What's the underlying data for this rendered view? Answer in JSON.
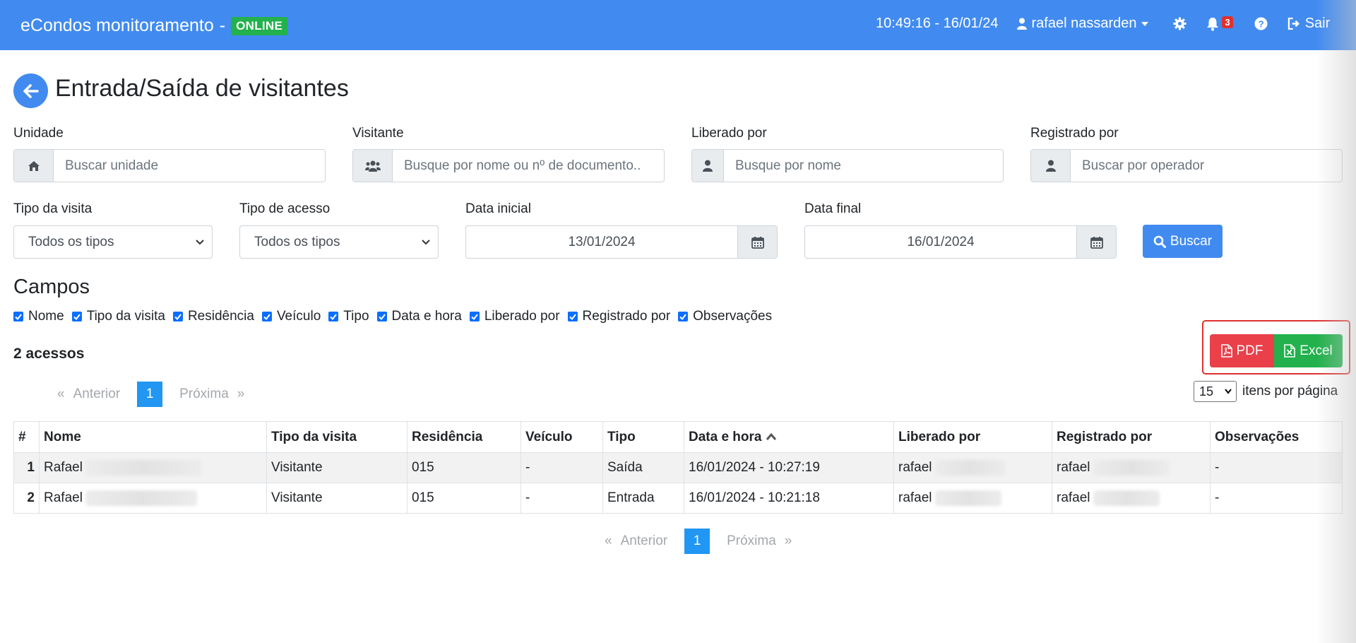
{
  "navbar": {
    "brand": "eCondos monitoramento",
    "separator": "-",
    "status": "ONLINE",
    "clock": "10:49:16 - 16/01/24",
    "user": "rafael nassarden",
    "notifications": "3",
    "logout": "Sair",
    "icons": [
      "user-icon",
      "caret-down-icon",
      "gear-icon",
      "bell-icon",
      "question-icon",
      "sign-out-icon"
    ]
  },
  "page": {
    "title": "Entrada/Saída de visitantes",
    "back_icon": "arrow-left-icon"
  },
  "filters": {
    "unidade": {
      "label": "Unidade",
      "placeholder": "Buscar unidade",
      "icon": "home-icon"
    },
    "visitante": {
      "label": "Visitante",
      "placeholder": "Busque por nome ou nº de documento..",
      "icon": "users-icon"
    },
    "liberado": {
      "label": "Liberado por",
      "placeholder": "Busque por nome",
      "icon": "user-icon"
    },
    "registrado": {
      "label": "Registrado por",
      "placeholder": "Buscar por operador",
      "icon": "user-icon"
    },
    "tipo_visita": {
      "label": "Tipo da visita",
      "value": "Todos os tipos"
    },
    "tipo_acesso": {
      "label": "Tipo de acesso",
      "value": "Todos os tipos"
    },
    "data_inicial": {
      "label": "Data inicial",
      "value": "13/01/2024",
      "icon": "calendar-icon"
    },
    "data_final": {
      "label": "Data final",
      "value": "16/01/2024",
      "icon": "calendar-icon"
    },
    "buscar": "Buscar"
  },
  "campos": {
    "title": "Campos",
    "items": [
      "Nome",
      "Tipo da visita",
      "Residência",
      "Veículo",
      "Tipo",
      "Data e hora",
      "Liberado por",
      "Registrado por",
      "Observações"
    ]
  },
  "results": {
    "count_label": "2 acessos"
  },
  "export": {
    "pdf": "PDF",
    "excel": "Excel"
  },
  "pagination": {
    "prev_arrow": "«",
    "prev": "Anterior",
    "current": "1",
    "next": "Próxima",
    "next_arrow": "»"
  },
  "per_page": {
    "value": "15",
    "label": "itens por página"
  },
  "table": {
    "headers": [
      "#",
      "Nome",
      "Tipo da visita",
      "Residência",
      "Veículo",
      "Tipo",
      "Data e hora",
      "Liberado por",
      "Registrado por",
      "Observações"
    ],
    "rows": [
      [
        "1",
        "Rafael",
        "Visitante",
        "015",
        "-",
        "Saída",
        "16/01/2024 - 10:27:19",
        "rafael",
        "rafael",
        "-"
      ],
      [
        "2",
        "Rafael",
        "Visitante",
        "015",
        "-",
        "Entrada",
        "16/01/2024 - 10:21:18",
        "rafael",
        "rafael",
        "-"
      ]
    ]
  },
  "colors": {
    "primary": "#418bf0",
    "success": "#22b14c",
    "danger": "#e9404a",
    "page_active": "#2196f3"
  }
}
